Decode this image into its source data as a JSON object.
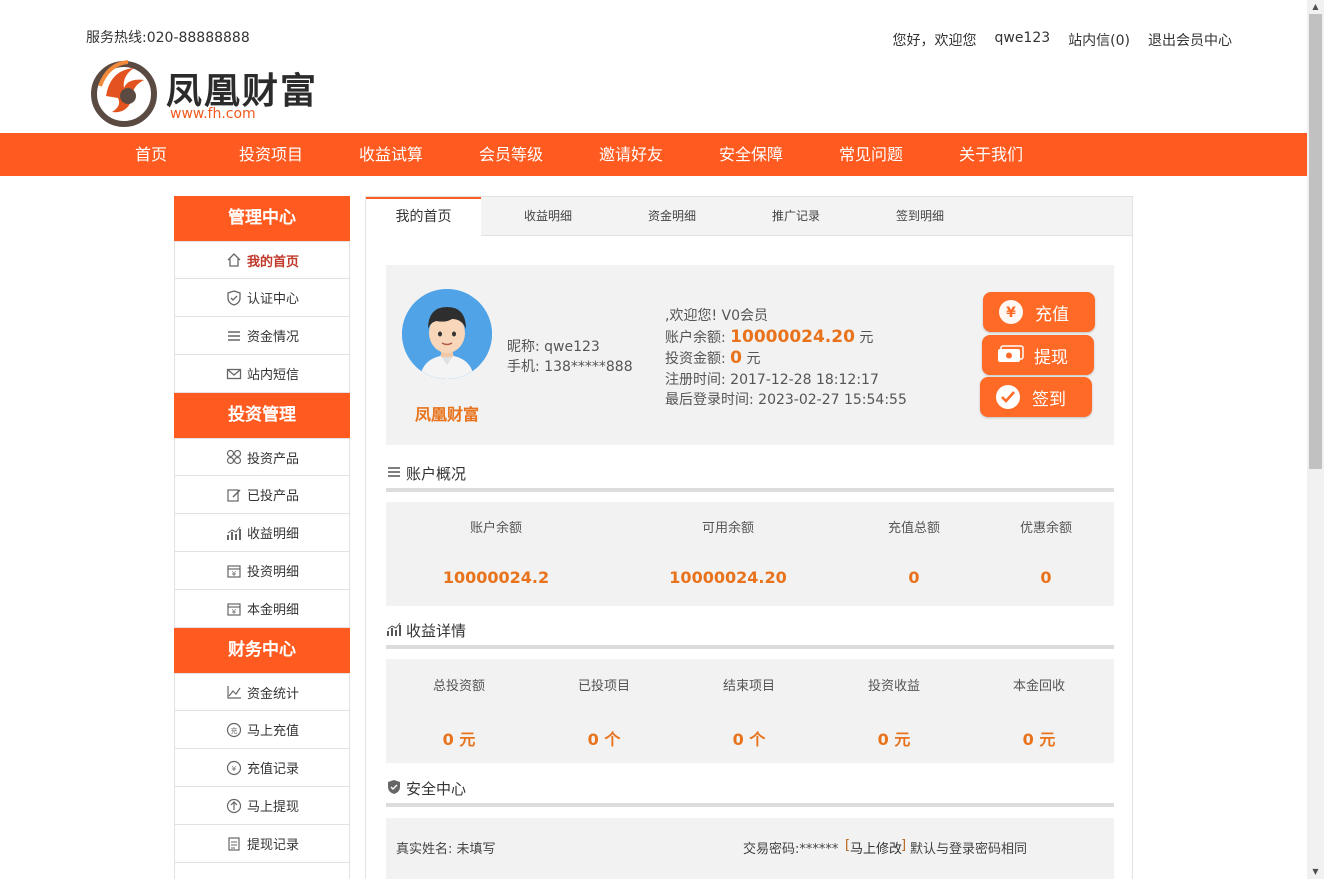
{
  "header": {
    "hotline": "服务热线:020-88888888",
    "greeting": "您好，欢迎您",
    "username": "qwe123",
    "messages": "站内信(0)",
    "logout": "退出会员中心",
    "logo_name": "凤凰财富",
    "logo_url": "www.fh.com"
  },
  "nav": [
    "首页",
    "投资项目",
    "收益试算",
    "会员等级",
    "邀请好友",
    "安全保障",
    "常见问题",
    "关于我们"
  ],
  "sidebar": {
    "groups": [
      {
        "title": "管理中心",
        "items": [
          {
            "label": "我的首页",
            "icon": "home-icon"
          },
          {
            "label": "认证中心",
            "icon": "shield-icon"
          },
          {
            "label": "资金情况",
            "icon": "list-icon"
          },
          {
            "label": "站内短信",
            "icon": "mail-icon"
          }
        ]
      },
      {
        "title": "投资管理",
        "items": [
          {
            "label": "投资产品",
            "icon": "grid-circles-icon"
          },
          {
            "label": "已投产品",
            "icon": "edit-icon"
          },
          {
            "label": "收益明细",
            "icon": "bar-chart-icon"
          },
          {
            "label": "投资明细",
            "icon": "calendar-yen-icon"
          },
          {
            "label": "本金明细",
            "icon": "calendar-yen-icon"
          }
        ]
      },
      {
        "title": "财务中心",
        "items": [
          {
            "label": "资金统计",
            "icon": "line-chart-icon"
          },
          {
            "label": "马上充值",
            "icon": "charge-icon"
          },
          {
            "label": "充值记录",
            "icon": "charge-record-icon"
          },
          {
            "label": "马上提现",
            "icon": "withdraw-icon"
          },
          {
            "label": "提现记录",
            "icon": "document-icon"
          }
        ]
      }
    ]
  },
  "tabs": [
    "我的首页",
    "收益明细",
    "资金明细",
    "推广记录",
    "签到明细"
  ],
  "profile": {
    "nickname_label": "昵称:",
    "nickname": "qwe123",
    "phone_label": "手机:",
    "phone": "138*****888",
    "brand": "凤凰财富",
    "welcome": ",欢迎您!  V0会员",
    "balance_label": "账户余额:",
    "balance": "10000024.20",
    "balance_unit": "元",
    "invest_label": "投资金额:",
    "invest": "0",
    "invest_unit": "元",
    "register_time": "注册时间: 2017-12-28 18:12:17",
    "last_login": "最后登录时间: 2023-02-27 15:54:55"
  },
  "buttons": {
    "recharge": "充值",
    "withdraw": "提现",
    "checkin": "签到"
  },
  "account_overview": {
    "title": "账户概况",
    "items": [
      {
        "label": "账户余额",
        "value": "10000024.2"
      },
      {
        "label": "可用余额",
        "value": "10000024.20"
      },
      {
        "label": "充值总额",
        "value": "0"
      },
      {
        "label": "优惠余额",
        "value": "0"
      }
    ]
  },
  "income_detail": {
    "title": "收益详情",
    "items": [
      {
        "label": "总投资额",
        "value": "0 元"
      },
      {
        "label": "已投项目",
        "value": "0 个"
      },
      {
        "label": "结束项目",
        "value": "0 个"
      },
      {
        "label": "投资收益",
        "value": "0 元"
      },
      {
        "label": "本金回收",
        "value": "0 元"
      }
    ]
  },
  "security": {
    "title": "安全中心",
    "real_name": "真实姓名: 未填写",
    "trade_pwd": "交易密码:******",
    "modify_link": "马上修改",
    "note": "默认与登录密码相同"
  },
  "colors": {
    "brand": "#ff5a1f",
    "accent_text": "#e8731c"
  }
}
